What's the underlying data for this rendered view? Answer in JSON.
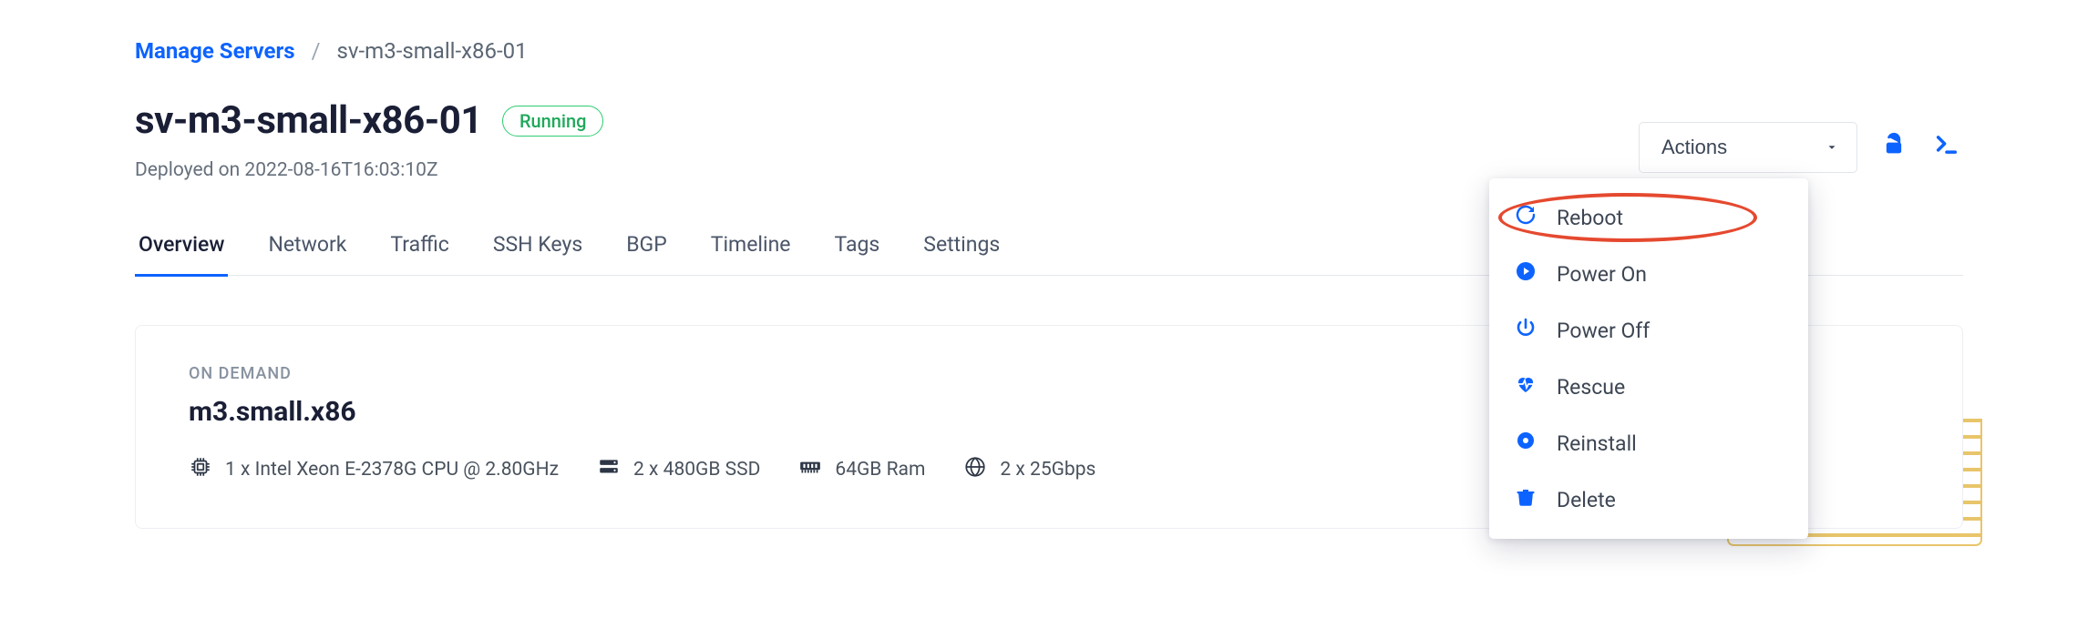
{
  "breadcrumb": {
    "root": "Manage Servers",
    "current": "sv-m3-small-x86-01"
  },
  "header": {
    "title": "sv-m3-small-x86-01",
    "status": "Running",
    "deployed_prefix": "Deployed on ",
    "deployed_at": "2022-08-16T16:03:10Z"
  },
  "tabs": [
    "Overview",
    "Network",
    "Traffic",
    "SSH Keys",
    "BGP",
    "Timeline",
    "Tags",
    "Settings"
  ],
  "active_tab_index": 0,
  "card": {
    "kicker": "ON DEMAND",
    "plan": "m3.small.x86",
    "specs": {
      "cpu": "1 x Intel Xeon E-2378G CPU @ 2.80GHz",
      "disk": "2 x 480GB SSD",
      "ram": "64GB Ram",
      "net": "2 x 25Gbps"
    }
  },
  "actions_button": {
    "label": "Actions"
  },
  "menu": [
    {
      "key": "reboot",
      "label": "Reboot"
    },
    {
      "key": "poweron",
      "label": "Power On"
    },
    {
      "key": "poweroff",
      "label": "Power Off"
    },
    {
      "key": "rescue",
      "label": "Rescue"
    },
    {
      "key": "reinstall",
      "label": "Reinstall"
    },
    {
      "key": "delete",
      "label": "Delete"
    }
  ],
  "highlighted_menu_index": 0
}
